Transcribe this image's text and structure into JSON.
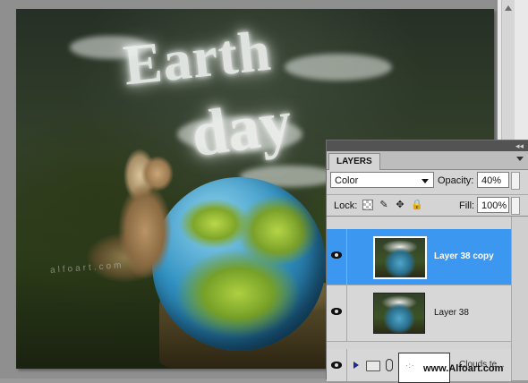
{
  "artwork": {
    "headline_line1": "Earth",
    "headline_line2": "day",
    "watermark": "alfoart.com"
  },
  "layers_panel": {
    "tab_label": "LAYERS",
    "blend_mode": "Color",
    "opacity_label": "Opacity:",
    "opacity_value": "40%",
    "lock_label": "Lock:",
    "fill_label": "Fill:",
    "fill_value": "100%",
    "layers": [
      {
        "name": "Layer 38 copy",
        "selected": true,
        "visible": true
      },
      {
        "name": "Layer 38",
        "selected": false,
        "visible": true
      }
    ],
    "group": {
      "name": "Clouds te...",
      "visible": true
    },
    "site_watermark": "www.Alfoart.com"
  },
  "colors": {
    "selection_blue": "#3c97f0",
    "panel_gray": "#d4d4d4"
  },
  "icons": [
    "eye-icon",
    "lock-transparent-pixels-icon",
    "brush-icon",
    "move-icon",
    "lock-icon",
    "folder-icon",
    "link-icon",
    "expand-triangle-icon",
    "collapse-icon"
  ]
}
